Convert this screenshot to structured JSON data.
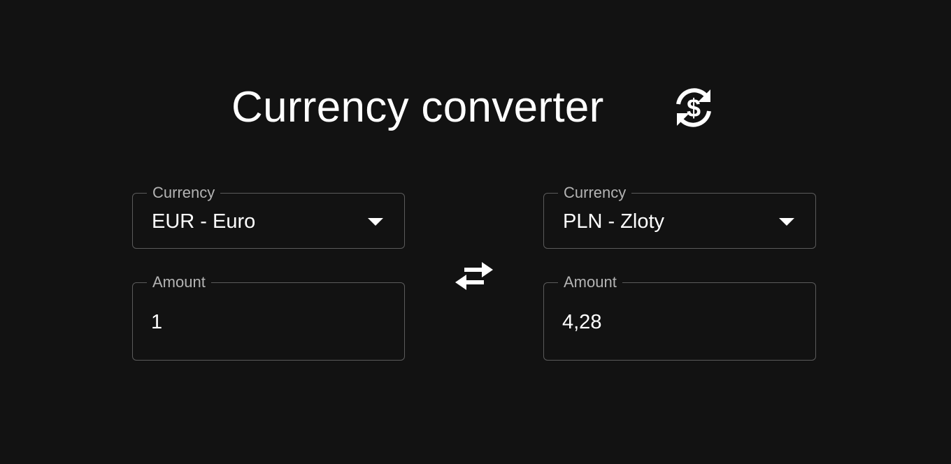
{
  "header": {
    "title": "Currency converter",
    "icon": "currency-exchange-icon"
  },
  "from": {
    "currency_label": "Currency",
    "currency_value": "EUR - Euro",
    "amount_label": "Amount",
    "amount_value": "1"
  },
  "to": {
    "currency_label": "Currency",
    "currency_value": "PLN - Zloty",
    "amount_label": "Amount",
    "amount_value": "4,28"
  },
  "swap": {
    "icon": "swap-arrows-icon"
  },
  "colors": {
    "background": "#121212",
    "text": "#ffffff",
    "label": "#b3b3b3",
    "border": "#5b5b5b"
  }
}
